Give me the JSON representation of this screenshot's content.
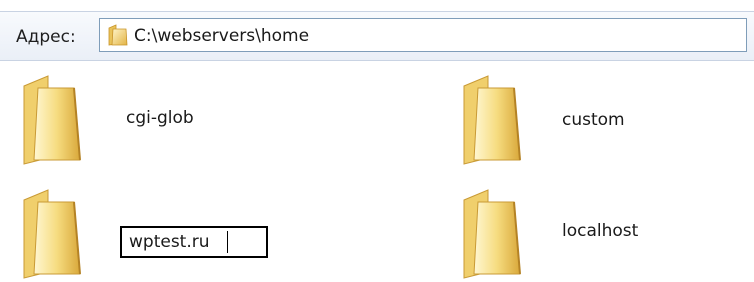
{
  "address_bar": {
    "label": "Адрес:",
    "path": "C:\\webservers\\home",
    "folder_icon": "folder-icon"
  },
  "items": [
    {
      "name": "cgi-glob",
      "icon": "folder-icon",
      "state": "normal"
    },
    {
      "name": "custom",
      "icon": "folder-icon",
      "state": "normal"
    },
    {
      "name": "wptest.ru",
      "icon": "folder-icon",
      "state": "renaming"
    },
    {
      "name": "localhost",
      "icon": "folder-icon",
      "state": "normal"
    }
  ],
  "colors": {
    "folder_light": "#fff3c0",
    "folder_mid": "#f4d16a",
    "folder_dark": "#d7a531",
    "address_border": "#7f9db9"
  }
}
